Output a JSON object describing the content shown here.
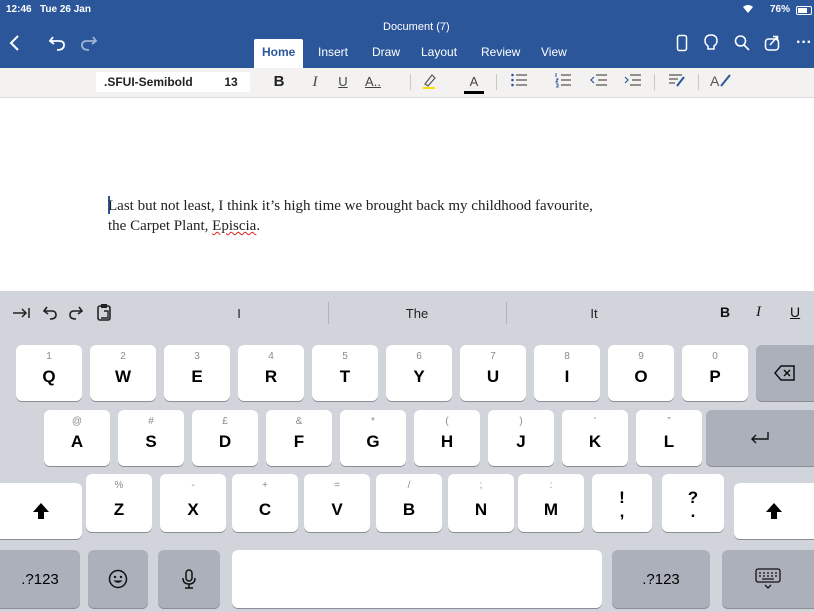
{
  "status_bar": {
    "time": "12:46",
    "date": "Tue 26 Jan",
    "battery": "76%"
  },
  "titlebar": {
    "doc_title": "Document (7)"
  },
  "tabs": [
    "Home",
    "Insert",
    "Draw",
    "Layout",
    "Review",
    "View"
  ],
  "ribbon": {
    "font_name": ".SFUI-Semibold",
    "font_size": "13",
    "bold": "B",
    "italic": "I",
    "underline": "U",
    "font_color": "A"
  },
  "document": {
    "line1": "Last but not least, I think it’s high time we brought back my childhood favourite,",
    "line2_start": "the Carpet Plant, ",
    "line2_word": "Episcia",
    "line2_end": "."
  },
  "suggestions": [
    "I",
    "The",
    "It"
  ],
  "format_buttons": {
    "bold": "B",
    "italic": "I",
    "underline": "U"
  },
  "keyboard": {
    "row1": [
      {
        "main": "Q",
        "sub": "1"
      },
      {
        "main": "W",
        "sub": "2"
      },
      {
        "main": "E",
        "sub": "3"
      },
      {
        "main": "R",
        "sub": "4"
      },
      {
        "main": "T",
        "sub": "5"
      },
      {
        "main": "Y",
        "sub": "6"
      },
      {
        "main": "U",
        "sub": "7"
      },
      {
        "main": "I",
        "sub": "8"
      },
      {
        "main": "O",
        "sub": "9"
      },
      {
        "main": "P",
        "sub": "0"
      }
    ],
    "row2": [
      {
        "main": "A",
        "sub": "@"
      },
      {
        "main": "S",
        "sub": "#"
      },
      {
        "main": "D",
        "sub": "£"
      },
      {
        "main": "F",
        "sub": "&"
      },
      {
        "main": "G",
        "sub": "*"
      },
      {
        "main": "H",
        "sub": "("
      },
      {
        "main": "J",
        "sub": ")"
      },
      {
        "main": "K",
        "sub": "’"
      },
      {
        "main": "L",
        "sub": "”"
      }
    ],
    "row3": [
      {
        "main": "Z",
        "sub": "%"
      },
      {
        "main": "X",
        "sub": "-"
      },
      {
        "main": "C",
        "sub": "+"
      },
      {
        "main": "V",
        "sub": "="
      },
      {
        "main": "B",
        "sub": "/"
      },
      {
        "main": "N",
        "sub": ";"
      },
      {
        "main": "M",
        "sub": ":"
      },
      {
        "main": ",",
        "sub": "!"
      },
      {
        "main": ".",
        "sub": "?"
      }
    ],
    "numbers_label": ".?123"
  },
  "colors": {
    "word_blue": "#2b579a",
    "keyboard_bg": "#d1d4da"
  }
}
